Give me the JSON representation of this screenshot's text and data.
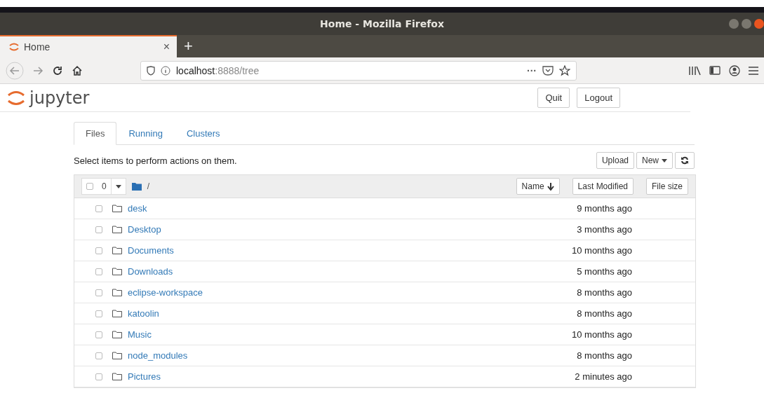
{
  "window": {
    "title": "Home - Mozilla Firefox"
  },
  "browser_tabs": [
    {
      "label": "Home",
      "close": "×",
      "selected": true
    }
  ],
  "new_tab": "+",
  "address_bar": {
    "host": "localhost",
    "path": ":8888/tree",
    "more": "···"
  },
  "header": {
    "logo": "jupyter",
    "buttons": [
      "Quit",
      "Logout"
    ]
  },
  "tabs": [
    {
      "label": "Files",
      "selected": true
    },
    {
      "label": "Running",
      "selected": false
    },
    {
      "label": "Clusters",
      "selected": false
    }
  ],
  "hint": "Select items to perform actions on them.",
  "actions": {
    "upload": "Upload",
    "new": "New"
  },
  "list_header": {
    "checked": false,
    "count": "0",
    "path": "/",
    "columns": [
      "Name",
      "Last Modified",
      "File size"
    ]
  },
  "rows": [
    {
      "name": "desk",
      "modified": "9 months ago",
      "checked": false
    },
    {
      "name": "Desktop",
      "modified": "3 months ago",
      "checked": false
    },
    {
      "name": "Documents",
      "modified": "10 months ago",
      "checked": false
    },
    {
      "name": "Downloads",
      "modified": "5 months ago",
      "checked": false
    },
    {
      "name": "eclipse-workspace",
      "modified": "8 months ago",
      "checked": false
    },
    {
      "name": "katoolin",
      "modified": "8 months ago",
      "checked": false
    },
    {
      "name": "Music",
      "modified": "10 months ago",
      "checked": false
    },
    {
      "name": "node_modules",
      "modified": "8 months ago",
      "checked": false
    },
    {
      "name": "Pictures",
      "modified": "2 minutes ago",
      "checked": false
    }
  ]
}
